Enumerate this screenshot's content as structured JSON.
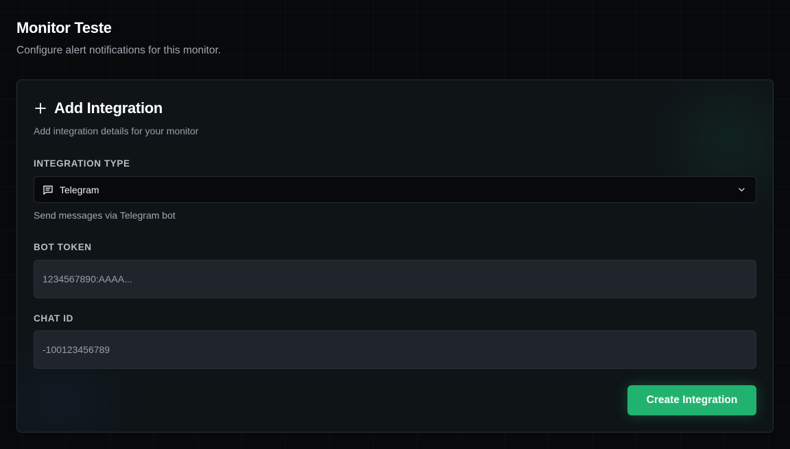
{
  "header": {
    "title": "Monitor Teste",
    "subtitle": "Configure alert notifications for this monitor."
  },
  "card": {
    "title": "Add Integration",
    "title_icon": "plus-icon",
    "description": "Add integration details for your monitor"
  },
  "integration_type": {
    "label": "INTEGRATION TYPE",
    "selected_value": "Telegram",
    "selected_icon": "message-square-icon",
    "chevron_icon": "chevron-down-icon",
    "help_text": "Send messages via Telegram bot"
  },
  "bot_token": {
    "label": "BOT TOKEN",
    "value": "",
    "placeholder": "1234567890:AAAA..."
  },
  "chat_id": {
    "label": "CHAT ID",
    "value": "",
    "placeholder": "-100123456789"
  },
  "actions": {
    "create_label": "Create Integration"
  },
  "colors": {
    "accent": "#22b270",
    "background": "#07090b",
    "card": "#0f1417",
    "input": "#1f252b"
  }
}
